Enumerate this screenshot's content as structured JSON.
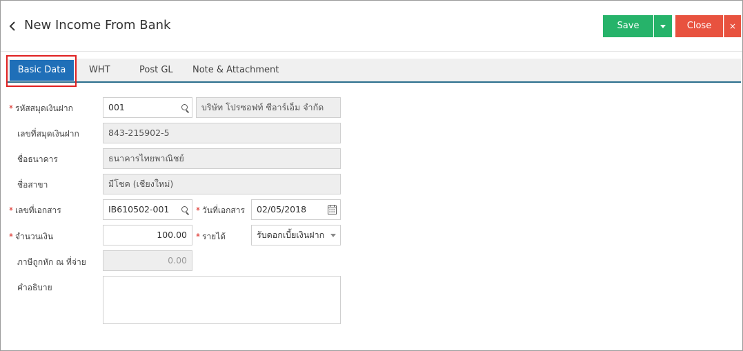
{
  "header": {
    "title": "New Income From Bank",
    "back_icon": "chevron-left-icon",
    "save_label": "Save",
    "close_label": "Close",
    "close_x": "×"
  },
  "colors": {
    "save": "#26b36a",
    "close": "#e8523f",
    "active_tab": "#1f6fb8",
    "required": "#d9241c"
  },
  "tabs": [
    {
      "label": "Basic Data",
      "active": true
    },
    {
      "label": "WHT",
      "active": false
    },
    {
      "label": "Post GL",
      "active": false
    },
    {
      "label": "Note & Attachment",
      "active": false
    }
  ],
  "form": {
    "req_mark": "*",
    "bankbook_code": {
      "label": "รหัสสมุดเงินฝาก",
      "value": "001",
      "name": "บริษัท โปรซอฟท์ ซีอาร์เอ็ม จำกัด"
    },
    "bankbook_no": {
      "label": "เลขที่สมุดเงินฝาก",
      "value": "843-215902-5"
    },
    "bank_name": {
      "label": "ชื่อธนาคาร",
      "value": "ธนาคารไทยพาณิชย์"
    },
    "branch_name": {
      "label": "ชื่อสาขา",
      "value": "มีโชค (เชียงใหม่)"
    },
    "doc_no": {
      "label": "เลขที่เอกสาร",
      "value": "IB610502-001"
    },
    "doc_date": {
      "label": "วันที่เอกสาร",
      "value": "02/05/2018"
    },
    "amount": {
      "label": "จำนวนเงิน",
      "value": "100.00"
    },
    "income": {
      "label": "รายได้",
      "value": "รับดอกเบี้ยเงินฝาก"
    },
    "wht": {
      "label": "ภาษีถูกหัก ณ ที่จ่าย",
      "value": "0.00"
    },
    "description": {
      "label": "คำอธิบาย",
      "value": ""
    }
  }
}
